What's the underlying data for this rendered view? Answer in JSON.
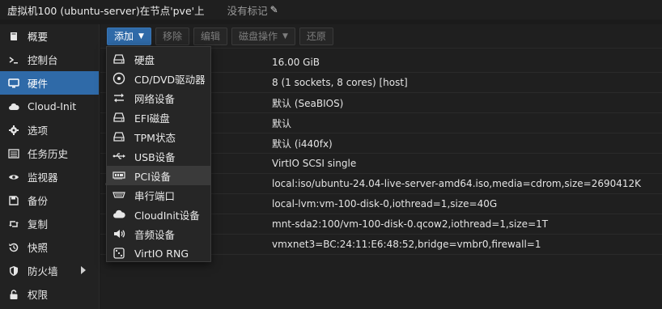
{
  "title": {
    "text": "虚拟机100 (ubuntu-server)在节点'pve'上",
    "tags": "没有标记"
  },
  "sidebar": {
    "items": [
      {
        "label": "概要",
        "icon": "book-icon"
      },
      {
        "label": "控制台",
        "icon": "terminal-icon"
      },
      {
        "label": "硬件",
        "icon": "monitor-icon",
        "active": true
      },
      {
        "label": "Cloud-Init",
        "icon": "cloud-icon"
      },
      {
        "label": "选项",
        "icon": "gear-icon"
      },
      {
        "label": "任务历史",
        "icon": "list-icon"
      },
      {
        "label": "监视器",
        "icon": "eye-icon"
      },
      {
        "label": "备份",
        "icon": "floppy-icon"
      },
      {
        "label": "复制",
        "icon": "retweet-icon"
      },
      {
        "label": "快照",
        "icon": "history-icon"
      },
      {
        "label": "防火墙",
        "icon": "shield-icon",
        "has_submenu": true
      },
      {
        "label": "权限",
        "icon": "unlock-icon"
      }
    ]
  },
  "toolbar": {
    "add_label": "添加",
    "remove_label": "移除",
    "edit_label": "编辑",
    "disk_action_label": "磁盘操作",
    "revert_label": "还原"
  },
  "hardware_rows": [
    {
      "left": "",
      "value": "16.00 GiB"
    },
    {
      "left": "",
      "value": "8 (1 sockets, 8 cores) [host]"
    },
    {
      "left": "",
      "value": "默认 (SeaBIOS)"
    },
    {
      "left": "",
      "value": "默认"
    },
    {
      "left": "",
      "value": "默认 (i440fx)"
    },
    {
      "left": "",
      "value": "VirtIO SCSI single"
    },
    {
      "left": "e2)",
      "value": "local:iso/ubuntu-24.04-live-server-amd64.iso,media=cdrom,size=2690412K"
    },
    {
      "left": "",
      "value": "local-lvm:vm-100-disk-0,iothread=1,size=40G"
    },
    {
      "left": "",
      "value": "mnt-sda2:100/vm-100-disk-0.qcow2,iothread=1,size=1T"
    },
    {
      "left": "",
      "value": "vmxnet3=BC:24:11:E6:48:52,bridge=vmbr0,firewall=1"
    }
  ],
  "add_menu": {
    "items": [
      {
        "label": "硬盘",
        "icon": "hdd-icon"
      },
      {
        "label": "CD/DVD驱动器",
        "icon": "dvd-icon"
      },
      {
        "label": "网络设备",
        "icon": "exchange-icon"
      },
      {
        "label": "EFI磁盘",
        "icon": "hdd-icon"
      },
      {
        "label": "TPM状态",
        "icon": "hdd-icon"
      },
      {
        "label": "USB设备",
        "icon": "usb-icon"
      },
      {
        "label": "PCI设备",
        "icon": "pci-card-icon",
        "hovered": true
      },
      {
        "label": "串行端口",
        "icon": "serial-port-icon"
      },
      {
        "label": "CloudInit设备",
        "icon": "cloud-icon"
      },
      {
        "label": "音频设备",
        "icon": "speaker-icon"
      },
      {
        "label": "VirtIO RNG",
        "icon": "dice-icon"
      }
    ]
  },
  "colors": {
    "accent": "#2f6aa8",
    "background": "#1b1b1b"
  }
}
